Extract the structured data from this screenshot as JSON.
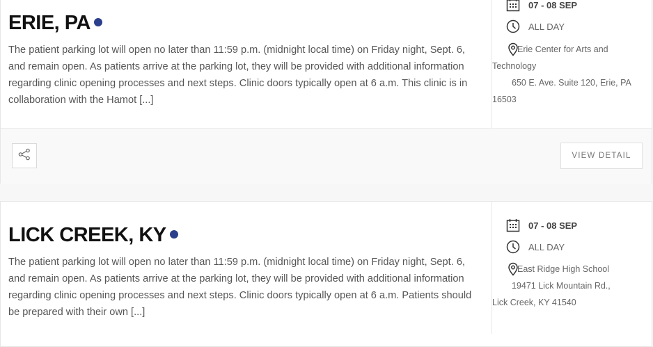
{
  "events": [
    {
      "title": "ERIE, PA",
      "description": "The patient parking lot will open no later than 11:59 p.m. (midnight local time) on Friday night, Sept. 6, and remain open. As patients arrive at the parking lot, they will be provided with additional information regarding clinic opening processes and next steps. Clinic doors typically open at 6 a.m. This clinic is in collaboration with the Hamot [...]",
      "date": "07 - 08 SEP",
      "time": "ALL DAY",
      "venue": "Erie Center for Arts and Technology",
      "address": "650 E. Ave. Suite 120, Erie, PA 16503",
      "share_icon": "share-icon",
      "detail_label": "VIEW DETAIL"
    },
    {
      "title": "LICK CREEK, KY",
      "description": "The patient parking lot will open no later than 11:59 p.m. (midnight local time) on Friday night, Sept. 6, and remain open. As patients arrive at the parking lot, they will be provided with additional information regarding clinic opening processes and next steps. Clinic doors typically open at 6 a.m.  Patients should be prepared with their own [...]",
      "date": "07 - 08 SEP",
      "time": "ALL DAY",
      "venue": "East Ridge High School",
      "address": "19471 Lick Mountain Rd., Lick Creek, KY 41540"
    }
  ],
  "colors": {
    "dot": "#2b3f8c",
    "title": "#111111",
    "text": "#555555"
  }
}
